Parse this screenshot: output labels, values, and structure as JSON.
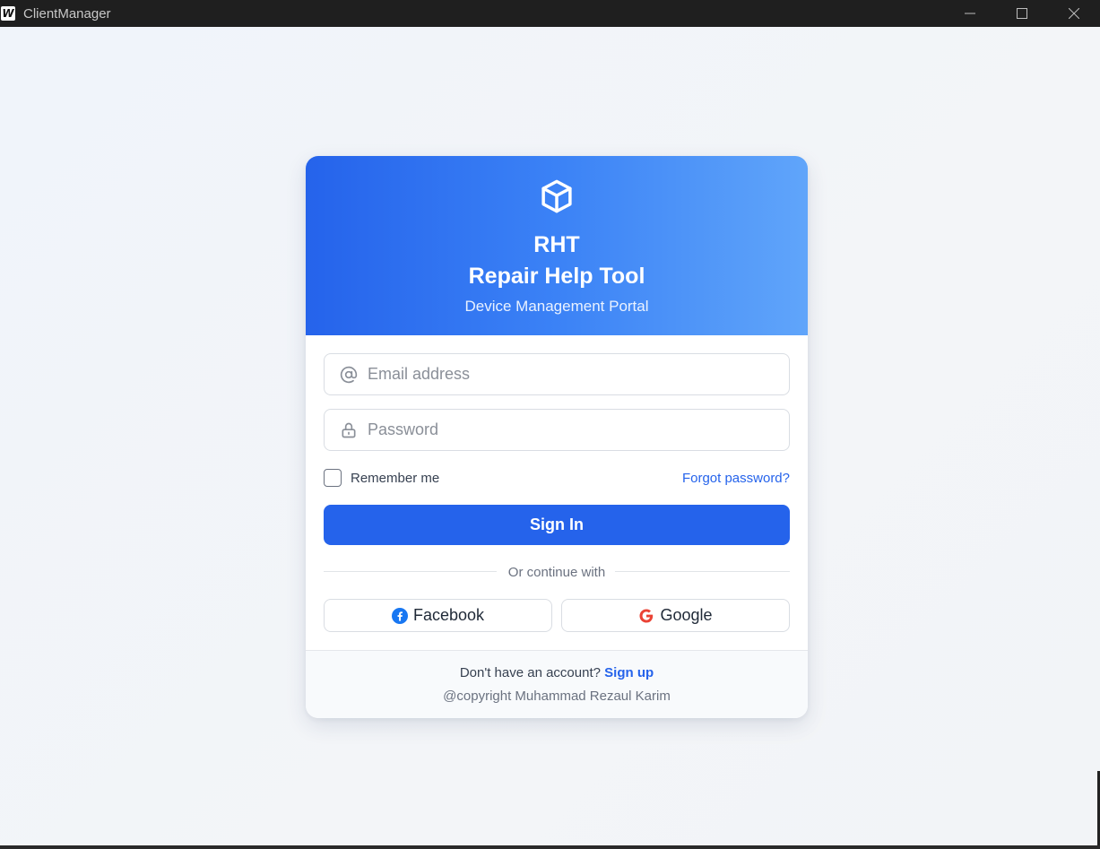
{
  "window": {
    "app_icon_letter": "W",
    "title": "ClientManager"
  },
  "brand": {
    "logo_icon": "cube-icon",
    "short_name": "RHT",
    "name": "Repair Help Tool",
    "subtitle": "Device Management Portal"
  },
  "form": {
    "email": {
      "placeholder": "Email address",
      "value": "",
      "icon": "at-sign-icon"
    },
    "password": {
      "placeholder": "Password",
      "value": "",
      "icon": "lock-icon"
    },
    "remember_label": "Remember me",
    "remember_checked": false,
    "forgot_label": "Forgot password?",
    "signin_label": "Sign In"
  },
  "social": {
    "divider_text": "Or continue with",
    "facebook_label": "Facebook",
    "google_label": "Google"
  },
  "footer": {
    "no_account_text": "Don't have an account?",
    "signup_label": "Sign up",
    "copyright": "@copyright Muhammad Rezaul Karim"
  },
  "colors": {
    "primary": "#2563eb",
    "header_gradient_start": "#2563eb",
    "header_gradient_end": "#60a5fa",
    "page_background": "#f1f4f8"
  }
}
